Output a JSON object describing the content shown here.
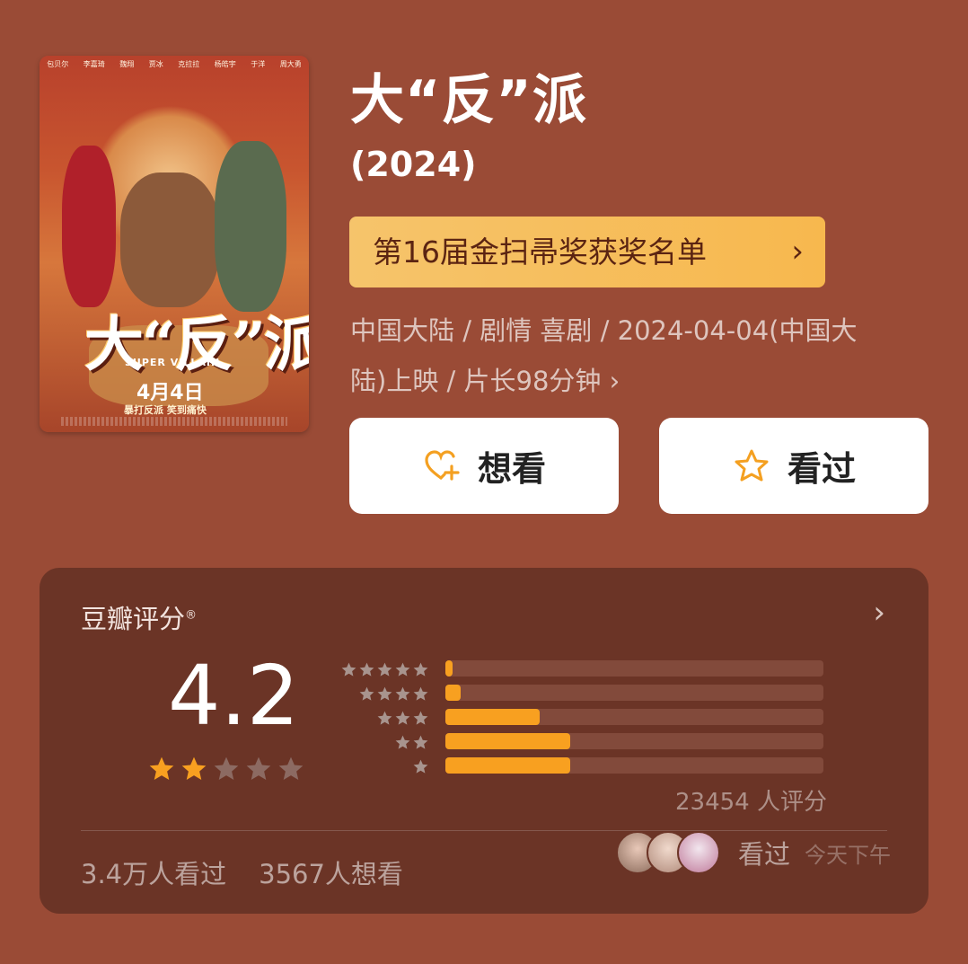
{
  "movie": {
    "title": "大“反”派",
    "year": "(2024)",
    "award_label": "第16届金扫帚奖获奖名单",
    "meta_line1": "中国大陆 / 剧情 喜剧 / 2024-04-04(中国大",
    "meta_line2": "陆)上映 / 片长98分钟 ›",
    "poster": {
      "cast": [
        "包贝尔",
        "李嘉琦",
        "魏翔",
        "贾冰",
        "克拉拉",
        "杨皓宇",
        "于洋",
        "周大勇"
      ],
      "title": "大“反”派",
      "subtitle": "SUPER VILLAIN",
      "date": "4月4日",
      "tagline": "暴打反派 笑到痛快"
    }
  },
  "actions": {
    "want": "想看",
    "seen": "看过"
  },
  "rating": {
    "label": "豆瓣评分",
    "registered_mark": "®",
    "score": "4.2",
    "stars": 2,
    "histogram_fractions": [
      0.02,
      0.04,
      0.25,
      0.33,
      0.33
    ],
    "count_text": "23454 人评分",
    "seen_text": "3.4万人看过",
    "want_text": "3567人想看",
    "friends_label": "看过",
    "friends_time": "今天下午"
  },
  "colors": {
    "background": "#9a4b36",
    "card": "#6b3426",
    "accent": "#f8a020",
    "award_bg": "#f6c46b"
  },
  "icons": {
    "want": "heart-plus-icon",
    "seen": "star-outline-icon",
    "award_chevron": "chevron-right-icon",
    "rating_chevron": "chevron-right-icon"
  }
}
